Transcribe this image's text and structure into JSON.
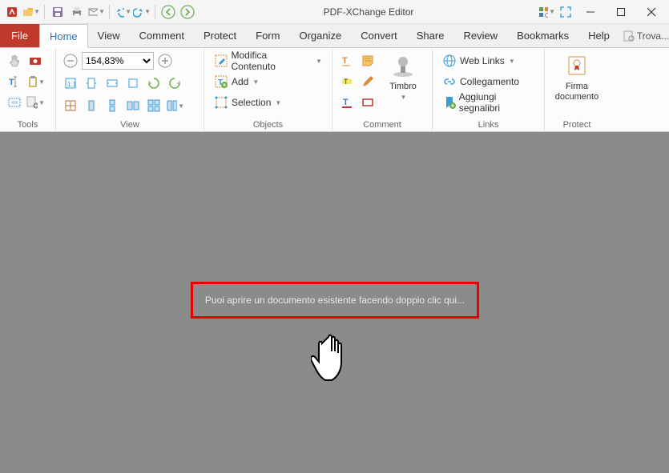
{
  "app": {
    "title": "PDF-XChange Editor"
  },
  "tabs": {
    "file": "File",
    "items": [
      "Home",
      "View",
      "Comment",
      "Protect",
      "Form",
      "Organize",
      "Convert",
      "Share",
      "Review",
      "Bookmarks",
      "Help"
    ],
    "active": "Home",
    "find_label": "Trova..."
  },
  "ribbon": {
    "tools": {
      "label": "Tools"
    },
    "view": {
      "label": "View",
      "zoom_value": "154,83%"
    },
    "objects": {
      "label": "Objects",
      "edit_content": "Modifica Contenuto",
      "add": "Add",
      "selection": "Selection"
    },
    "comment": {
      "label": "Comment",
      "stamp": "Timbro"
    },
    "links": {
      "label": "Links",
      "web_links": "Web Links",
      "link": "Collegamento",
      "add_bookmarks": "Aggiungi segnalibri"
    },
    "protect": {
      "label": "Protect",
      "sign": "Firma documento"
    }
  },
  "content": {
    "hint": "Puoi aprire un documento esistente facendo doppio clic qui..."
  }
}
